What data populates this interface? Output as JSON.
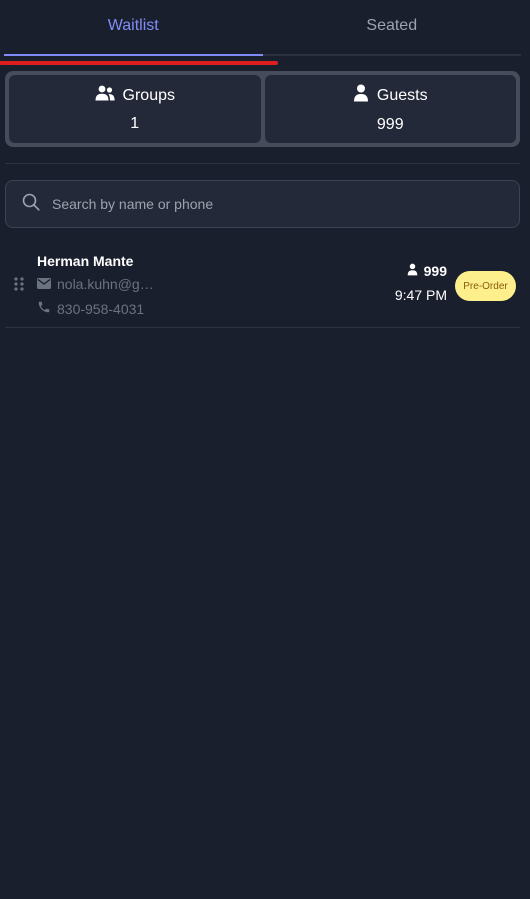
{
  "tabs": {
    "waitlist": "Waitlist",
    "seated": "Seated"
  },
  "stats": {
    "groups": {
      "label": "Groups",
      "value": "1"
    },
    "guests": {
      "label": "Guests",
      "value": "999"
    }
  },
  "search": {
    "placeholder": "Search by name or phone",
    "value": ""
  },
  "entries": [
    {
      "name": "Herman Mante",
      "email": "nola.kuhn@g…",
      "phone": "830-958-4031",
      "party_size": "999",
      "time": "9:47 PM",
      "badge": "Pre-Order"
    }
  ],
  "icons": {
    "groups": "users-icon",
    "guests": "user-icon",
    "search": "search-icon",
    "drag": "drag-handle-icon",
    "email": "envelope-icon",
    "phone": "phone-icon",
    "party": "user-icon"
  },
  "colors": {
    "background": "#1a1f2e",
    "accent": "#818cf8",
    "badge_bg": "#fdf08c",
    "badge_text": "#8a5a0b",
    "annotation": "#dc1e1e"
  }
}
